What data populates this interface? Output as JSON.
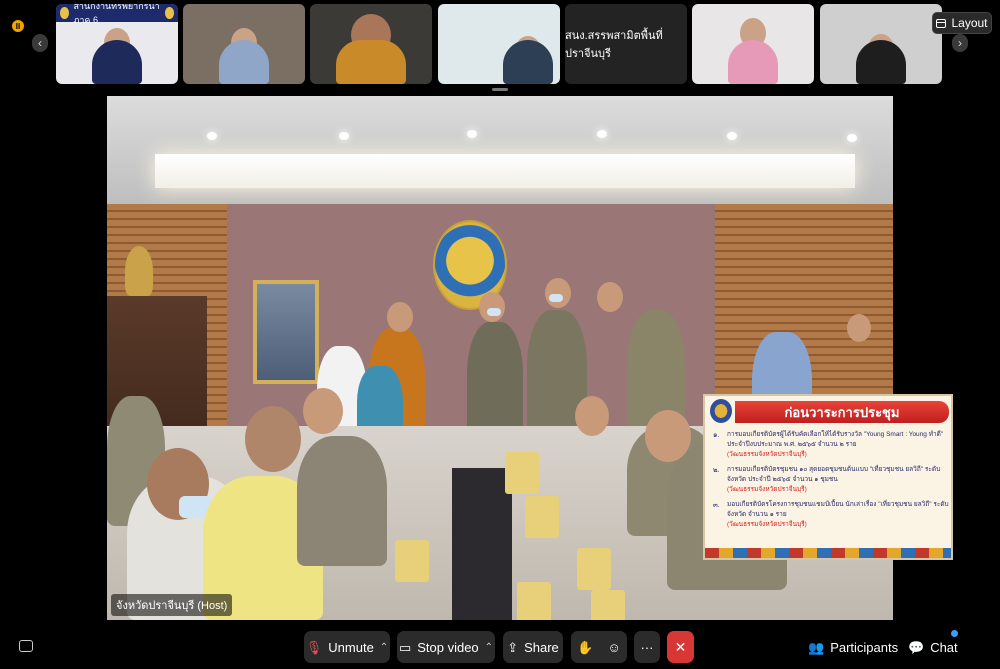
{
  "top_strip": {
    "tiles": [
      {
        "label": "",
        "banner": "สำนักงานทรัพยากรน้ำภาค 6",
        "type": "video"
      },
      {
        "label": "",
        "type": "video"
      },
      {
        "label": "",
        "type": "video"
      },
      {
        "label": "",
        "type": "video"
      },
      {
        "label": "สนง.สรรพสามิตพื้นที่ปราจีนบุรี",
        "type": "name"
      },
      {
        "label": "",
        "type": "video"
      },
      {
        "label": "",
        "type": "video"
      }
    ],
    "layout_label": "Layout",
    "prev_glyph": "‹",
    "next_glyph": "›",
    "pause_glyph": "II"
  },
  "main_video": {
    "host_label": "จังหวัดปราจีนบุรี (Host)",
    "slide": {
      "title": "ก่อนวาระการประชุม",
      "items": [
        {
          "num": "๑.",
          "text": "การมอบเกียรติบัตรผู้ได้รับคัดเลือกให้ได้รับรางวัล \"Young Smart : Young ทำดี\" ประจำปีงบประมาณ พ.ศ. ๒๕๖๕ จำนวน ๒ ราย",
          "source": "(วัฒนธรรมจังหวัดปราจีนบุรี)"
        },
        {
          "num": "๒.",
          "text": "การมอบเกียรติบัตรชุมชน ๑๐ สุดยอดชุมชนต้นแบบ \"เที่ยวชุมชน ยลวิถี\" ระดับจังหวัด ประจำปี ๒๕๖๕ จำนวน ๑ ชุมชน",
          "source": "(วัฒนธรรมจังหวัดปราจีนบุรี)"
        },
        {
          "num": "๓.",
          "text": "มอบเกียรติบัตรโครงการชุมชนแชมป์เปี้ยน นักเล่าเรื่อง \"เที่ยวชุมชน ยลวิถี\" ระดับจังหวัด จำนวน ๑ ราย",
          "source": "(วัฒนธรรมจังหวัดปราจีนบุรี)"
        }
      ]
    }
  },
  "toolbar": {
    "unmute": "Unmute",
    "stop_video": "Stop video",
    "share": "Share",
    "participants": "Participants",
    "chat": "Chat",
    "more_glyph": "···",
    "leave_glyph": "✕",
    "caret_glyph": "⌃"
  },
  "colors": {
    "leave_red": "#d93636",
    "toolbar_btn": "#2b2b2b",
    "slide_title_red": "#c01f1f",
    "chat_badge": "#3aa0ff"
  }
}
